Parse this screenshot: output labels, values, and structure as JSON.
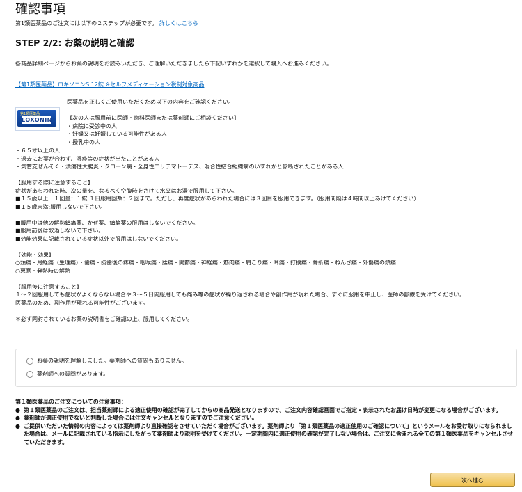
{
  "header": {
    "title": "確認事項",
    "subtitle": "第1類医薬品のご注文には以下の２ステップが必要です。",
    "subtitle_link": "詳しくはこちら"
  },
  "step": {
    "title": "STEP 2/2: お薬の説明と確認",
    "intro": "各商品詳細ページからお薬の説明をお読みいただき、ご理解いただきましたら下記いずれかを選択して購入へお進みください。"
  },
  "product": {
    "name": "【第1類医薬品】ロキソニンS 12錠 ※セルフメディケーション税制対象商品",
    "image_brand": "LOXONIN",
    "image_tag": "第1類医薬品"
  },
  "description": {
    "top_lines": [
      "医薬品を正しくご使用いただくため以下の内容をご確認ください。",
      "",
      "【次の人は服用前に医師・歯科医師または薬剤師にご相談ください】",
      "・病院に受診中の人",
      "・妊婦又は妊娠している可能性がある人",
      "・授乳中の人"
    ],
    "lines": [
      "・６５才以上の人",
      "・過去にお薬が合わず、湿疹等の症状が出たことがある人",
      "・気管支ぜんそく・潰瘍性大腸炎・クローン病・全身性エリテマトーデス、混合性結合組織病のいずれかと診断されたことがある人",
      "",
      "【服用する際に注意すること】",
      "症状があらわれた時、次の量を、なるべく空腹時をさけて水又はお湯で服用して下さい。",
      "■１５歳以上　１回量：１錠 １日服用回数：２回まで。ただし、再度症状があらわれた場合には３回目を服用できます。（服用間隔は４時間以上あけてください）",
      "■１５歳未満:服用しないで下さい。",
      "",
      "■服用中は他の解熱鎮痛薬、かぜ薬、鎮静薬の服用はしないでください。",
      "■服用前後は飲酒しないで下さい。",
      "■効能効果に記載されている症状以外で服用はしないでください。",
      "",
      "【効能・効果】",
      "○頭痛・月経痛（生理痛）・歯痛・抜歯後の疼痛・咽喉痛・腰痛・関節痛・神経痛・筋肉痛・肩こり痛・耳痛・打撲痛・骨折痛・ねんざ痛・外傷痛の鎮痛",
      "○悪寒・発熱時の解熱",
      "",
      "【服用後に注意すること】",
      "１～２回服用しても症状がよくならない場合や３～５日間服用しても痛み等の症状が繰り返される場合や副作用が現れた場合、すぐに服用を中止し、医師の診療を受けてください。",
      "医薬品のため、副作用が現れる可能性がございます。",
      "",
      "＊必ず同封されているお薬の説明書をご確認の上、服用してください。"
    ]
  },
  "options": [
    "お薬の説明を理解しました。薬剤師への質問もありません。",
    "薬剤師への質問があります。"
  ],
  "notes": {
    "title": "第１類医薬品のご注文についての注意事項：",
    "items": [
      "第１類医薬品のご注文は、担当薬剤師による適正使用の確認が完了してからの商品発送となりますので、ご注文内容確認画面でご指定・表示されたお届け日時が変更になる場合がございます。",
      "薬剤師が適正使用でないと判断した場合には注文キャンセルとなりますのでご注意ください。",
      "ご提供いただいた情報の内容によっては薬剤師より直接確認をさせていただく場合がございます。薬剤師より「第１類医薬品の適正使用のご確認について」というメールをお受け取りになられました場合は、メールに記載されている指示にしたがって薬剤師より説明を受けてください。一定期間内に適正使用の確認が完了しない場合は、ご注文に含まれる全ての第１類医薬品をキャンセルさせていただきます。"
    ],
    "bullet": "●"
  },
  "buttons": {
    "next": "次へ進む"
  }
}
